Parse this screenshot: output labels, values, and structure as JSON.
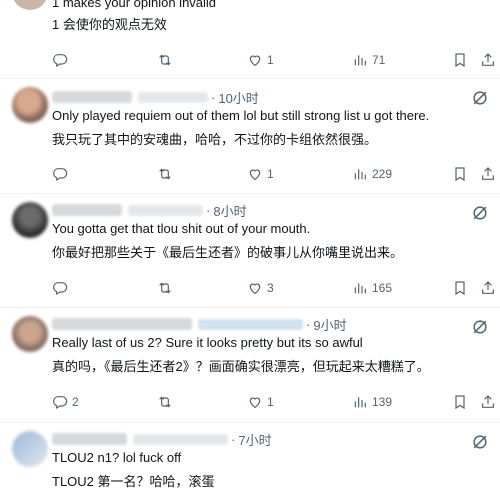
{
  "colors": {
    "icon": "#536471",
    "text": "#0f1419",
    "divider": "#eff3f4"
  },
  "top_partial": {
    "text_en": "1 makes your opinion invalid",
    "text_zh": "1 会使你的观点无效",
    "likes": "1",
    "views": "71"
  },
  "replies": [
    {
      "time": "10小时",
      "text_en": "Only played requiem out of them lol but still strong list u got there.",
      "text_zh": "我只玩了其中的安魂曲，哈哈，不过你的卡组依然很强。",
      "replies_count": "",
      "likes": "1",
      "views": "229"
    },
    {
      "time": "8小时",
      "text_en": "You gotta get that tlou shit out of your mouth.",
      "text_zh": "你最好把那些关于《最后生还者》的破事儿从你嘴里说出来。",
      "replies_count": "",
      "likes": "3",
      "views": "165"
    },
    {
      "time": "9小时",
      "text_en": "Really last of us 2? Sure it looks pretty but its so awful",
      "text_zh": "真的吗，《最后生还者2》？画面确实很漂亮，但玩起来太糟糕了。",
      "replies_count": "2",
      "likes": "1",
      "views": "139"
    },
    {
      "time": "7小时",
      "text_en": "TLOU2 n1? lol fuck off",
      "text_zh": "TLOU2 第一名？哈哈，滚蛋",
      "replies_count": "",
      "likes": "",
      "views": ""
    }
  ]
}
